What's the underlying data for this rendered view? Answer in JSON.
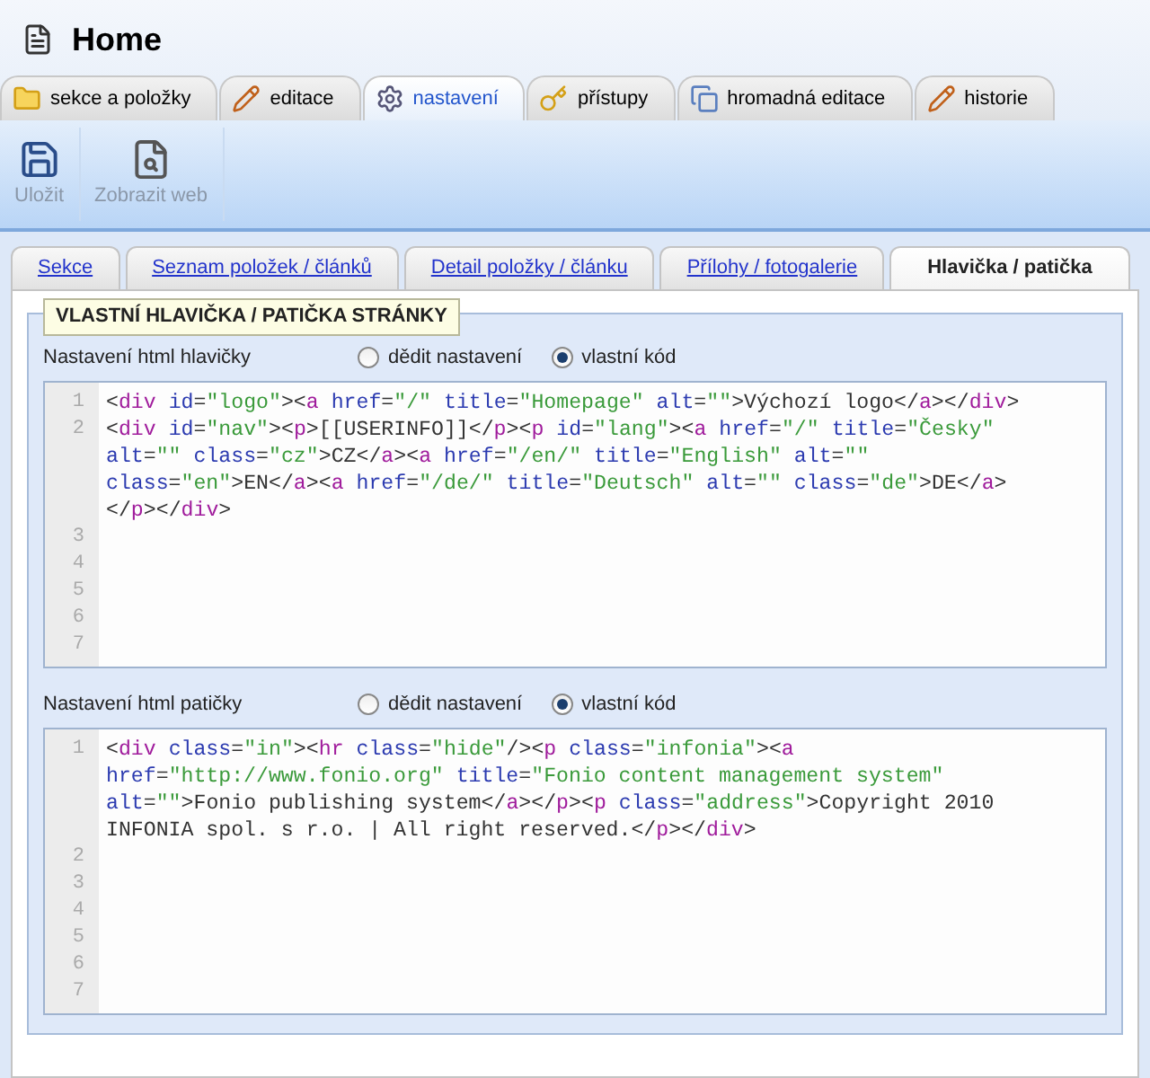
{
  "page": {
    "title": "Home"
  },
  "main_tabs": [
    {
      "label": "sekce a položky",
      "kind": "folder",
      "selected": false
    },
    {
      "label": "editace",
      "kind": "pencil",
      "selected": false
    },
    {
      "label": "nastavení",
      "kind": "gear",
      "selected": true
    },
    {
      "label": "přístupy",
      "kind": "key",
      "selected": false
    },
    {
      "label": "hromadná editace",
      "kind": "copy",
      "selected": false
    },
    {
      "label": "historie",
      "kind": "pencil",
      "selected": false
    }
  ],
  "toolbar": [
    {
      "label": "Uložit",
      "kind": "save",
      "disabled": true
    },
    {
      "label": "Zobrazit web",
      "kind": "preview",
      "disabled": true
    }
  ],
  "sub_tabs": [
    {
      "label": "Sekce",
      "selected": false
    },
    {
      "label": "Seznam položek / článků",
      "selected": false
    },
    {
      "label": "Detail položky / článku",
      "selected": false
    },
    {
      "label": "Přílohy / fotogalerie",
      "selected": false
    },
    {
      "label": "Hlavička / patička",
      "selected": true
    }
  ],
  "fieldset": {
    "legend": "VLASTNÍ HLAVIČKA / PATIČKA STRÁNKY",
    "sections": [
      {
        "label": "Nastavení html hlavičky",
        "options": [
          {
            "label": "dědit nastavení",
            "selected": false
          },
          {
            "label": "vlastní kód",
            "selected": true
          }
        ],
        "lines": [
          {
            "number": "1",
            "code": "<div id=\"logo\"><a href=\"/\" title=\"Homepage\" alt=\"\">Výchozí logo</a></div>"
          },
          {
            "number": "2",
            "code": "<div id=\"nav\"><p>[[USERINFO]]</p><p id=\"lang\"><a href=\"/\" title=\"Česky\" alt=\"\" class=\"cz\">CZ</a><a href=\"/en/\" title=\"English\" alt=\"\" class=\"en\">EN</a><a href=\"/de/\" title=\"Deutsch\" alt=\"\" class=\"de\">DE</a></p></div>"
          },
          {
            "number": "3"
          },
          {
            "number": "4"
          },
          {
            "number": "5"
          },
          {
            "number": "6"
          },
          {
            "number": "7"
          }
        ]
      },
      {
        "label": "Nastavení html patičky",
        "options": [
          {
            "label": "dědit nastavení",
            "selected": false
          },
          {
            "label": "vlastní kód",
            "selected": true
          }
        ],
        "lines": [
          {
            "number": "1",
            "code": "<div class=\"in\"><hr class=\"hide\"/><p class=\"infonia\"><a href=\"http://www.fonio.org\" title=\"Fonio content management system\" alt=\"\">Fonio publishing system</a></p><p class=\"address\">Copyright 2010 INFONIA spol. s r.o. | All right reserved.</p></div>"
          },
          {
            "number": "2"
          },
          {
            "number": "3"
          },
          {
            "number": "4"
          },
          {
            "number": "5"
          },
          {
            "number": "6"
          },
          {
            "number": "7"
          }
        ]
      }
    ]
  }
}
